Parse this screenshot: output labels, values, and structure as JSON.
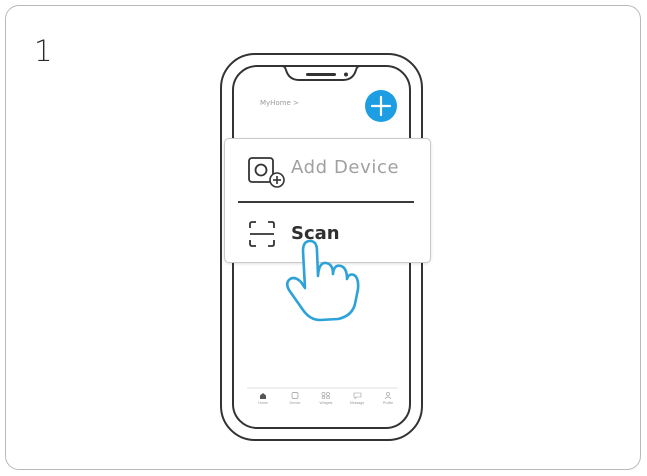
{
  "step_number": "1",
  "phone": {
    "home_title": "MyHome  >",
    "add_button_icon": "plus-icon",
    "tabs": [
      {
        "label": "Home",
        "icon": "home-icon"
      },
      {
        "label": "Device",
        "icon": "device-icon"
      },
      {
        "label": "Widgets",
        "icon": "widgets-icon"
      },
      {
        "label": "Message",
        "icon": "message-icon"
      },
      {
        "label": "Profile",
        "icon": "profile-icon"
      }
    ]
  },
  "popup_menu": {
    "items": [
      {
        "label": "Add Device",
        "icon": "add-device-icon"
      },
      {
        "label": "Scan",
        "icon": "scan-icon"
      }
    ]
  },
  "colors": {
    "accent": "#1d9ee2",
    "outline": "#333333",
    "hand": "#2ca2d9"
  },
  "pointer": {
    "icon": "pointing-hand-icon"
  }
}
